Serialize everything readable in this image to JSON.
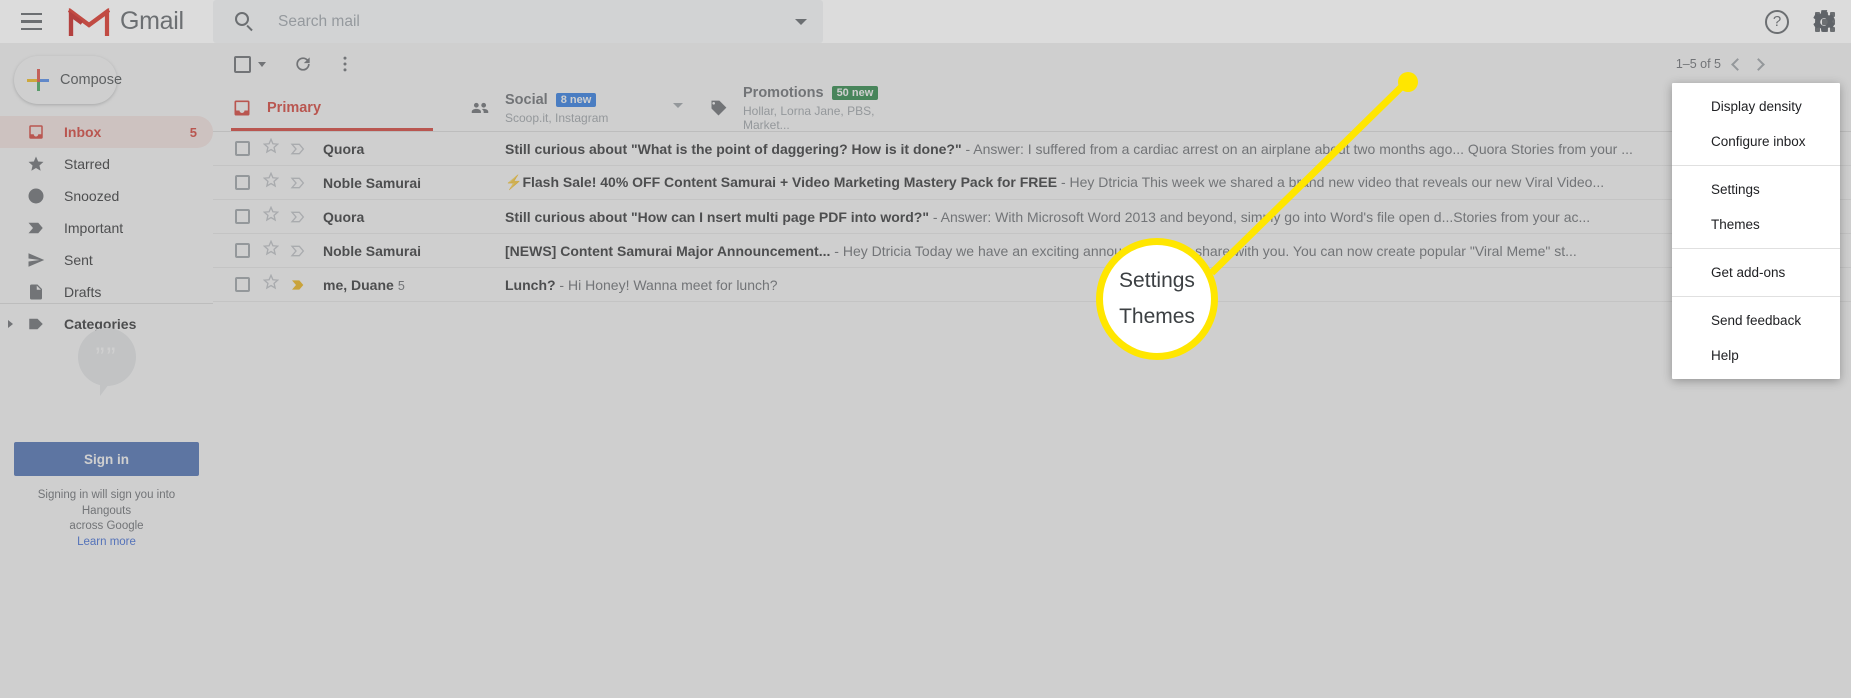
{
  "topbar": {
    "menu_icon": "hamburger-icon",
    "logo_text": "Gmail",
    "search_placeholder": "Search mail",
    "search_value": "",
    "search_icon": "search-icon",
    "search_options_icon": "chevron-down-icon",
    "help_icon_label": "?",
    "apps_icon": "apps-grid-icon"
  },
  "sidebar": {
    "compose_label": "Compose",
    "items": [
      {
        "label": "Inbox",
        "count": "5",
        "icon": "inbox-icon",
        "active": true
      },
      {
        "label": "Starred",
        "count": "",
        "icon": "star-icon",
        "active": false
      },
      {
        "label": "Snoozed",
        "count": "",
        "icon": "clock-icon",
        "active": false
      },
      {
        "label": "Important",
        "count": "",
        "icon": "important-icon",
        "active": false
      },
      {
        "label": "Sent",
        "count": "",
        "icon": "send-icon",
        "active": false
      },
      {
        "label": "Drafts",
        "count": "",
        "icon": "draft-icon",
        "active": false
      },
      {
        "label": "Categories",
        "count": "",
        "icon": "label-icon",
        "active": false,
        "expandable": true
      }
    ],
    "hangouts": {
      "quote_glyph": "””",
      "signin_label": "Sign in",
      "note_line1": "Signing in will sign you into Hangouts",
      "note_line2": "across Google",
      "learn_more": "Learn more"
    }
  },
  "toolbar": {
    "select_all_icon": "checkbox-icon",
    "select_dropdown_icon": "chevron-down-icon",
    "refresh_icon": "refresh-icon",
    "more_icon": "more-vertical-icon",
    "pager_text": "1–5 of 5",
    "prev_icon": "chevron-left-icon",
    "next_icon": "chevron-right-icon",
    "settings_icon": "gear-icon"
  },
  "tabs": [
    {
      "label": "Primary",
      "badge": "",
      "badge_color": "",
      "sub": "",
      "icon": "inbox-icon",
      "active": true,
      "has_dropdown": false
    },
    {
      "label": "Social",
      "badge": "8 new",
      "badge_color": "#1a73e8",
      "sub": "Scoop.it, Instagram",
      "icon": "people-icon",
      "active": false,
      "has_dropdown": true
    },
    {
      "label": "Promotions",
      "badge": "50 new",
      "badge_color": "#188038",
      "sub": "Hollar, Lorna Jane, PBS, Market...",
      "icon": "tag-icon",
      "active": false,
      "has_dropdown": false
    }
  ],
  "emails": [
    {
      "sender": "Quora",
      "count": "",
      "subject": "Still curious about \"What is the point of daggering? How is it done?\"",
      "snippet": " - Answer: I suffered from a cardiac arrest on an airplane about two months ago... Quora Stories from your ...",
      "starred": false,
      "important": false,
      "bolt": false
    },
    {
      "sender": "Noble Samurai",
      "count": "",
      "subject": "Flash Sale! 40% OFF Content Samurai + Video Marketing Mastery Pack for FREE",
      "snippet": " - Hey Dtricia This week we shared a brand new video that reveals our new Viral Video...",
      "starred": false,
      "important": false,
      "bolt": true
    },
    {
      "sender": "Quora",
      "count": "",
      "subject": "Still curious about \"How can I nsert multi page PDF into word?\"",
      "snippet": " - Answer: With Microsoft Word 2013 and beyond, simply go into Word's file open d...Stories from your ac...",
      "starred": false,
      "important": false,
      "bolt": false
    },
    {
      "sender": "Noble Samurai",
      "count": "",
      "subject": "[NEWS] Content Samurai Major Announcement...",
      "snippet": " - Hey Dtricia Today we have an exciting announcement to share with you. You can now create popular \"Viral Meme\" st...",
      "starred": false,
      "important": false,
      "bolt": false
    },
    {
      "sender": "me, Duane",
      "count": "5",
      "subject": "Lunch?",
      "snippet": " - Hi Honey! Wanna meet for lunch?",
      "starred": false,
      "important": true,
      "bolt": false
    }
  ],
  "settings_menu": {
    "items": [
      {
        "label": "Display density",
        "separator_after": false
      },
      {
        "label": "Configure inbox",
        "separator_after": true
      },
      {
        "label": "Settings",
        "separator_after": false
      },
      {
        "label": "Themes",
        "separator_after": true
      },
      {
        "label": "Get add-ons",
        "separator_after": true
      },
      {
        "label": "Send feedback",
        "separator_after": false
      },
      {
        "label": "Help",
        "separator_after": false
      }
    ]
  },
  "callout": {
    "magnified_line1": "Settings",
    "magnified_line2": "Themes",
    "highlight_color": "#ffe600"
  }
}
